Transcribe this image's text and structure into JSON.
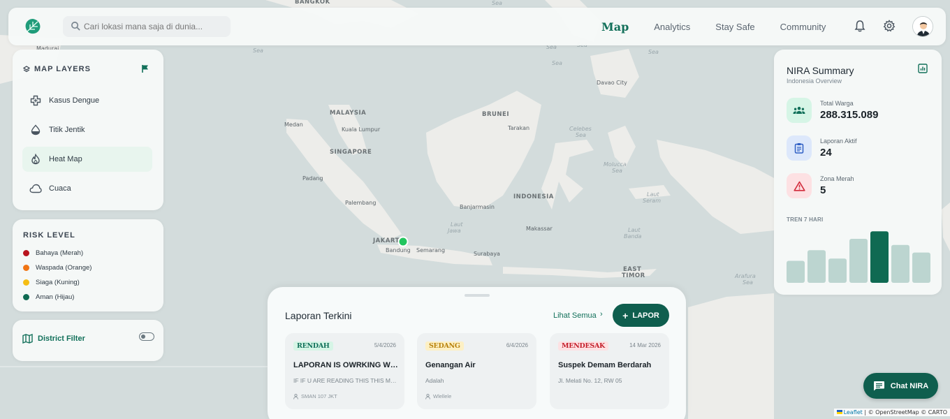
{
  "header": {
    "search_placeholder": "Cari lokasi mana saja di dunia...",
    "nav": [
      {
        "label": "Map",
        "active": true
      },
      {
        "label": "Analytics",
        "active": false
      },
      {
        "label": "Stay Safe",
        "active": false
      },
      {
        "label": "Community",
        "active": false
      }
    ],
    "icons": [
      "bell-icon",
      "gear-icon",
      "avatar"
    ]
  },
  "map_layers": {
    "title": "MAP LAYERS",
    "items": [
      {
        "label": "Kasus Dengue",
        "icon": "medical-cross-icon",
        "active": false
      },
      {
        "label": "Titik Jentik",
        "icon": "droplet-icon",
        "active": false
      },
      {
        "label": "Heat Map",
        "icon": "flame-icon",
        "active": true
      },
      {
        "label": "Cuaca",
        "icon": "cloud-icon",
        "active": false
      }
    ]
  },
  "risk_level": {
    "title": "RISK LEVEL",
    "items": [
      {
        "label": "Bahaya (Merah)",
        "color": "#b8141e"
      },
      {
        "label": "Waspada (Orange)",
        "color": "#f07414"
      },
      {
        "label": "Siaga (Kuning)",
        "color": "#f5bd14"
      },
      {
        "label": "Aman (Hijau)",
        "color": "#0f6a52"
      }
    ]
  },
  "district_filter": {
    "label": "District Filter",
    "enabled": false
  },
  "summary": {
    "title": "NIRA Summary",
    "subtitle": "Indonesia Overview",
    "stats": [
      {
        "label": "Total Warga",
        "value": "288.315.089",
        "icon": "group-icon",
        "bg": "#d6f5e6",
        "fg": "#12705a"
      },
      {
        "label": "Laporan Aktif",
        "value": "24",
        "icon": "clipboard-icon",
        "bg": "#dde8fb",
        "fg": "#2f5fc4"
      },
      {
        "label": "Zona Merah",
        "value": "5",
        "icon": "warning-icon",
        "bg": "#fde1e3",
        "fg": "#d22c3c"
      }
    ],
    "trend_label": "TREN 7 HARI"
  },
  "chart_data": {
    "type": "bar",
    "title": "TREN 7 HARI",
    "categories": [
      "1",
      "2",
      "3",
      "4",
      "5",
      "6",
      "7"
    ],
    "values": [
      29,
      43,
      32,
      58,
      68,
      50,
      40
    ],
    "ylim": [
      0,
      70
    ],
    "highlight_index": 4,
    "colors": {
      "normal": "#bcd5d0",
      "highlight": "#0f6a52"
    }
  },
  "reports": {
    "title": "Laporan Terkini",
    "see_all": "Lihat Semua",
    "chevron": "›",
    "lapor_label": "LAPOR",
    "lapor_plus": "+",
    "cards": [
      {
        "severity": "RENDAH",
        "sev_bg": "#d6f5e6",
        "sev_fg": "#12705a",
        "date": "5/4/2026",
        "title": "LAPORAN IS OWRKING WUHU...",
        "desc": "IF IF U ARE READING THIS THIS MEANS...",
        "location": "SMAN 107 JKT"
      },
      {
        "severity": "SEDANG",
        "sev_bg": "#fdf0c4",
        "sev_fg": "#b8820c",
        "date": "6/4/2026",
        "title": "Genangan Air",
        "desc": "Adalah",
        "location": "Wlellele"
      },
      {
        "severity": "MENDESAK",
        "sev_bg": "#fde1e3",
        "sev_fg": "#c41e2a",
        "date": "14 Mar 2026",
        "title": "Suspek Demam Berdarah",
        "desc": "Jl. Melati No. 12, RW 05",
        "location": ""
      }
    ]
  },
  "chat": {
    "label": "Chat NIRA"
  },
  "map": {
    "labels": {
      "bangkok": "BANGKOK",
      "madurai": "Madurai",
      "malaysia": "MALAYSIA",
      "brunei": "BRUNEI",
      "medan": "Medan",
      "kuala_lumpur": "Kuala Lumpur",
      "singapore": "SINGAPORE",
      "tarakan": "Tarakan",
      "padang": "Padang",
      "palembang": "Palembang",
      "banjarmasin": "Banjarmasin",
      "indonesia": "INDONESIA",
      "jakarta": "JAKARTA",
      "bandung": "Bandung",
      "semarang": "Semarang",
      "surabaya": "Surabaya",
      "makassar": "Makassar",
      "east_timor_1": "EAST",
      "east_timor_2": "TIMOR",
      "davao": "Davao City",
      "seas": [
        "Sea",
        "Sea",
        "Sea",
        "Sea",
        "Sea",
        "Sea",
        "Celebes",
        "Sea",
        "Molucca",
        "Sea",
        "Laut",
        "Seram",
        "Laut",
        "Jawa",
        "Laut",
        "Banda",
        "Arafura",
        "Sea"
      ]
    },
    "attribution_leaflet": "Leaflet",
    "attribution_rest": " | © OpenStreetMap © CARTO"
  }
}
